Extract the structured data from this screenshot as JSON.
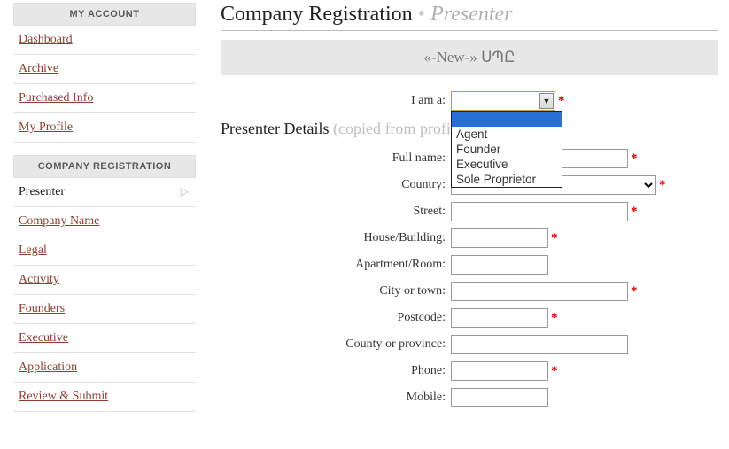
{
  "sidebar": {
    "account": {
      "header": "MY ACCOUNT",
      "items": [
        {
          "label": "Dashboard"
        },
        {
          "label": "Archive"
        },
        {
          "label": "Purchased Info"
        },
        {
          "label": "My Profile"
        }
      ]
    },
    "reg": {
      "header": "COMPANY REGISTRATION",
      "items": [
        {
          "label": "Presenter",
          "active": true
        },
        {
          "label": "Company Name"
        },
        {
          "label": "Legal"
        },
        {
          "label": "Activity"
        },
        {
          "label": "Founders"
        },
        {
          "label": "Executive"
        },
        {
          "label": "Application"
        },
        {
          "label": "Review & Submit"
        }
      ]
    }
  },
  "page": {
    "title_main": "Company Registration",
    "title_sep": " • ",
    "title_sub": "Presenter",
    "banner": "«-New-» ՍՊԸ",
    "section_title": "Presenter Details ",
    "section_hint": "(copied from profile)"
  },
  "i_am": {
    "label": "I am a:",
    "value": "",
    "options": [
      "",
      "Agent",
      "Founder",
      "Executive",
      "Sole Proprietor"
    ]
  },
  "form": {
    "fields": [
      {
        "label": "Full name:",
        "value": "",
        "width": "w200",
        "required": true
      },
      {
        "label": "Country:",
        "value": "",
        "kind": "select",
        "width": "w230",
        "required": true
      },
      {
        "label": "Street:",
        "value": "",
        "width": "w200",
        "required": true
      },
      {
        "label": "House/Building:",
        "value": "",
        "width": "w110",
        "required": true
      },
      {
        "label": "Apartment/Room:",
        "value": "",
        "width": "w110",
        "required": false
      },
      {
        "label": "City or town:",
        "value": "",
        "width": "w200",
        "required": true
      },
      {
        "label": "Postcode:",
        "value": "",
        "width": "w110",
        "required": true
      },
      {
        "label": "County or province:",
        "value": "",
        "width": "w200",
        "required": false
      },
      {
        "label": "Phone:",
        "value": "",
        "width": "w110",
        "required": true
      },
      {
        "label": "Mobile:",
        "value": "",
        "width": "w110",
        "required": false
      }
    ]
  },
  "glyphs": {
    "triangle_right": "▷",
    "triangle_down": "▼",
    "asterisk": "*"
  }
}
